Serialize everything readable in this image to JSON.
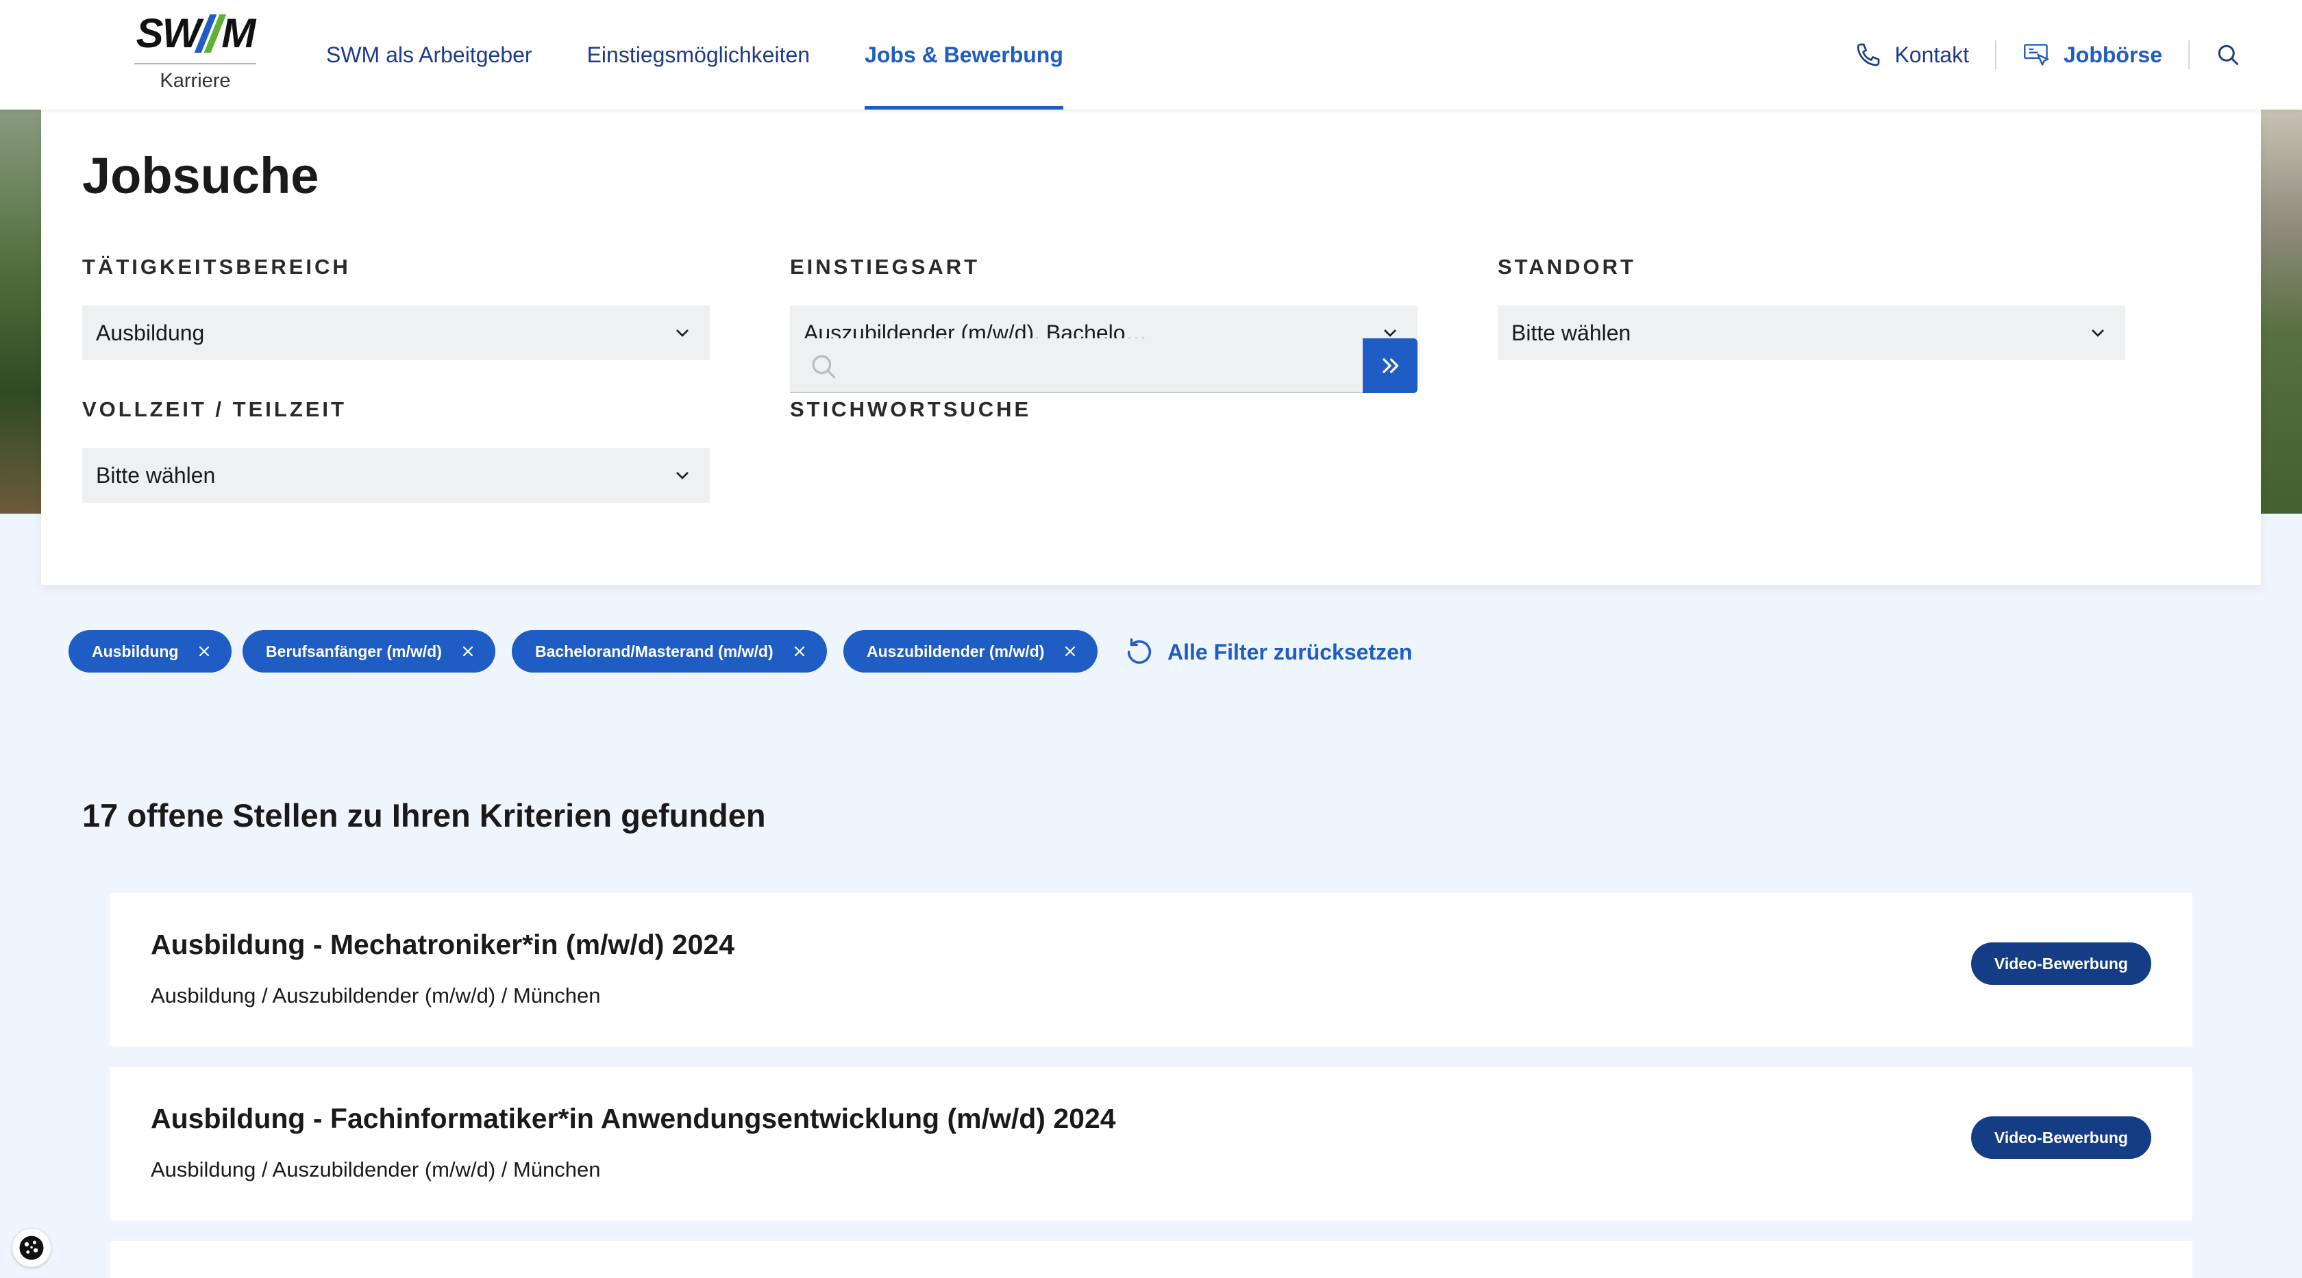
{
  "header": {
    "logo_text": "SW//M",
    "logo_sub": "Karriere",
    "nav": [
      {
        "label": "SWM als Arbeitgeber"
      },
      {
        "label": "Einstiegsmöglichkeiten"
      },
      {
        "label": "Jobs & Bewerbung"
      }
    ],
    "active_nav": "Jobs & Bewerbung",
    "contact_label": "Kontakt",
    "jobboard_label": "Jobbörse",
    "icons": [
      "phone-icon",
      "job-board-icon",
      "search-icon"
    ]
  },
  "filters": {
    "title": "Jobsuche",
    "taetigkeitsbereich": {
      "label": "TÄTIGKEITSBEREICH",
      "value": "Ausbildung"
    },
    "einstiegsart": {
      "label": "EINSTIEGSART",
      "value": "Auszubildender (m/w/d), Bachelo…"
    },
    "standort": {
      "label": "STANDORT",
      "value": "Bitte wählen"
    },
    "vollzeit": {
      "label": "VOLLZEIT / TEILZEIT",
      "value": "Bitte wählen"
    },
    "stichwort": {
      "label": "STICHWORTSUCHE",
      "value": "",
      "placeholder": ""
    }
  },
  "chips": [
    {
      "label": "Ausbildung"
    },
    {
      "label": "Berufsanfänger (m/w/d)"
    },
    {
      "label": "Bachelorand/Masterand (m/w/d)"
    },
    {
      "label": "Auszubildender (m/w/d)"
    }
  ],
  "reset_label": "Alle Filter zurücksetzen",
  "results": {
    "count_text": "17 offene Stellen zu Ihren Kriterien gefunden",
    "jobs": [
      {
        "title": "Ausbildung - Mechatroniker*in (m/w/d) 2024",
        "meta": "Ausbildung / Auszubildender (m/w/d) / München",
        "badge": "Video-Bewerbung"
      },
      {
        "title": "Ausbildung - Fachinformatiker*in Anwendungsentwicklung (m/w/d) 2024",
        "meta": "Ausbildung / Auszubildender (m/w/d) / München",
        "badge": "Video-Bewerbung"
      }
    ]
  },
  "colors": {
    "accent": "#1f5cc4",
    "navy": "#153d86",
    "page_bg": "#eef5fc",
    "field_bg": "#eef0f2"
  }
}
